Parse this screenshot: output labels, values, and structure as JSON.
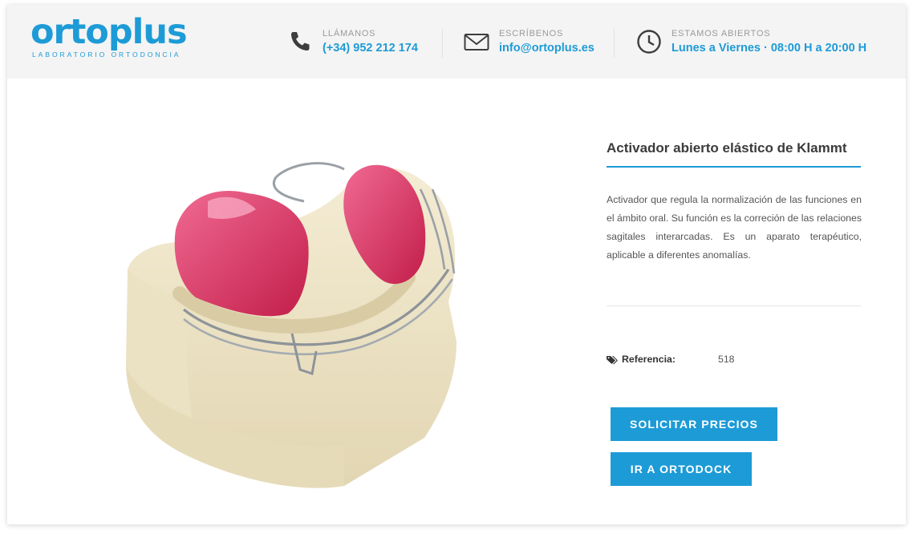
{
  "header": {
    "logo": {
      "name": "ortoplus",
      "tagline": "LABORATORIO ORTODONCIA"
    },
    "phone": {
      "label": "LLÁMANOS",
      "value": "(+34) 952 212 174",
      "icon": "phone-icon"
    },
    "email": {
      "label": "ESCRÍBENOS",
      "value": "info@ortoplus.es",
      "icon": "envelope-icon"
    },
    "hours": {
      "label": "ESTAMOS ABIERTOS",
      "value": "Lunes a Viernes · 08:00 H a 20:00 H",
      "icon": "clock-icon"
    }
  },
  "product": {
    "title": "Activador abierto elástico de Klammt",
    "description": "Activador que regula la normalización de las funciones en el ámbito oral. Su función es la correción de las relaciones sagitales interarcadas. Es un aparato terapéutico, aplicable a diferentes anomalías.",
    "reference": {
      "icon": "tags-icon",
      "label": "Referencia:",
      "value": "518"
    },
    "buttons": {
      "precios": "SOLICITAR PRECIOS",
      "ortodock": "IR A ORTODOCK"
    }
  },
  "colors": {
    "accent": "#1d9bd7",
    "header_bg": "#f4f4f4",
    "acrylic": "#d8305a",
    "plaster": "#efe6cc"
  }
}
